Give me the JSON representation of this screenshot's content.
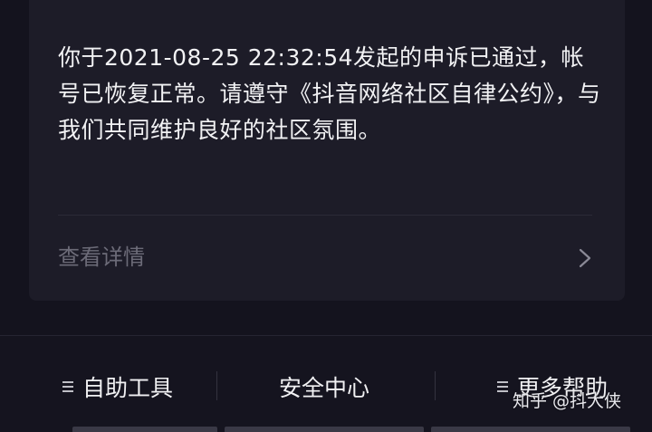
{
  "card": {
    "message": "你于2021-08-25 22:32:54发起的申诉已通过，帐号已恢复正常。请遵守《抖音网络社区自律公约》，与我们共同维护良好的社区氛围。",
    "details_label": "查看详情"
  },
  "toolbar": {
    "items": [
      {
        "label": "自助工具",
        "icon": "menu-icon"
      },
      {
        "label": "安全中心"
      },
      {
        "label": "更多帮助",
        "icon": "menu-icon"
      }
    ]
  },
  "watermark": "知乎 @抖大侠",
  "colors": {
    "background": "#14131e",
    "card": "#1d1c28",
    "text_primary": "#f2f2f4",
    "text_muted": "#6c6b78"
  }
}
